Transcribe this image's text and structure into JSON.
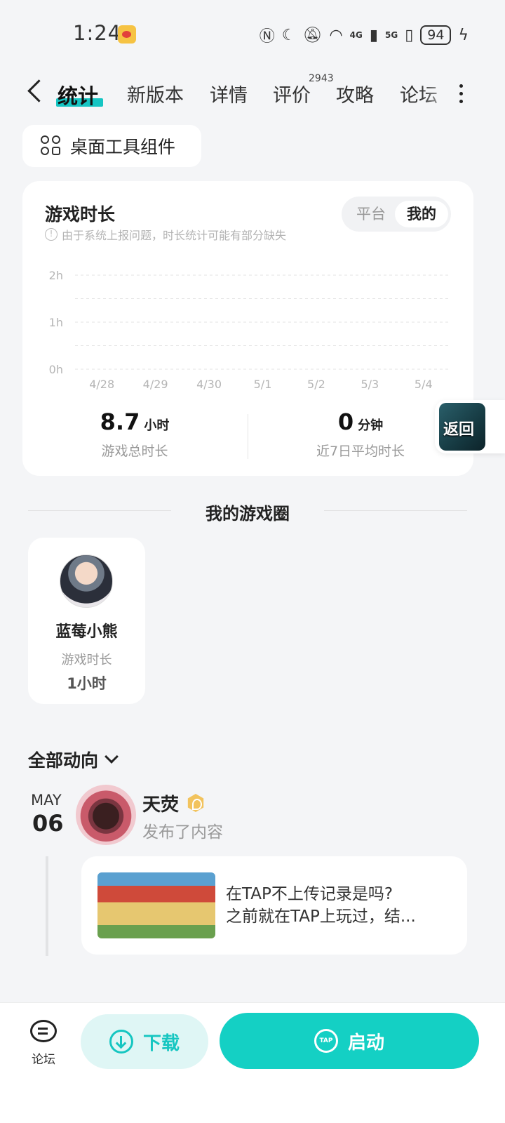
{
  "status_bar": {
    "time": "1:24",
    "network_4g": "4G",
    "network_5g": "5G",
    "battery": "94"
  },
  "tabs": [
    {
      "label": "统计",
      "active": true
    },
    {
      "label": "新版本"
    },
    {
      "label": "详情"
    },
    {
      "label": "评价",
      "badge": "2943"
    },
    {
      "label": "攻略"
    },
    {
      "label": "论坛"
    }
  ],
  "widget_chip": {
    "label": "桌面工具组件"
  },
  "stats_card": {
    "title": "游戏时长",
    "note": "由于系统上报问题，时长统计可能有部分缺失",
    "toggle": {
      "left": "平台",
      "right": "我的",
      "selected": "我的"
    },
    "total": {
      "value": "8.7",
      "unit": "小时",
      "caption": "游戏总时长"
    },
    "avg": {
      "value": "0",
      "unit": "分钟",
      "caption": "近7日平均时长"
    }
  },
  "chart_data": {
    "type": "bar",
    "categories": [
      "4/28",
      "4/29",
      "4/30",
      "5/1",
      "5/2",
      "5/3",
      "5/4"
    ],
    "values": [
      0,
      0,
      0,
      0,
      0,
      0,
      0
    ],
    "y_ticks": [
      "2h",
      "1h",
      "0h"
    ],
    "ylim": [
      0,
      2
    ],
    "grid": true
  },
  "float_return": {
    "label": "返回"
  },
  "game_circle": {
    "title": "我的游戏圈",
    "friends": [
      {
        "name": "蓝莓小熊",
        "label": "游戏时长",
        "value": "1小时"
      }
    ]
  },
  "feed": {
    "filter_label": "全部动向",
    "items": [
      {
        "month": "MAY",
        "day": "06",
        "user": "天荧",
        "action": "发布了内容",
        "text_line1": "在TAP不上传记录是吗?",
        "text_line2": "之前就在TAP上玩过，结..."
      }
    ]
  },
  "bottom_bar": {
    "forum_label": "论坛",
    "download_label": "下载",
    "launch_label": "启动",
    "tap_text": "TAP"
  },
  "colors": {
    "accent": "#15c5c3",
    "background": "#f4f5f7"
  }
}
